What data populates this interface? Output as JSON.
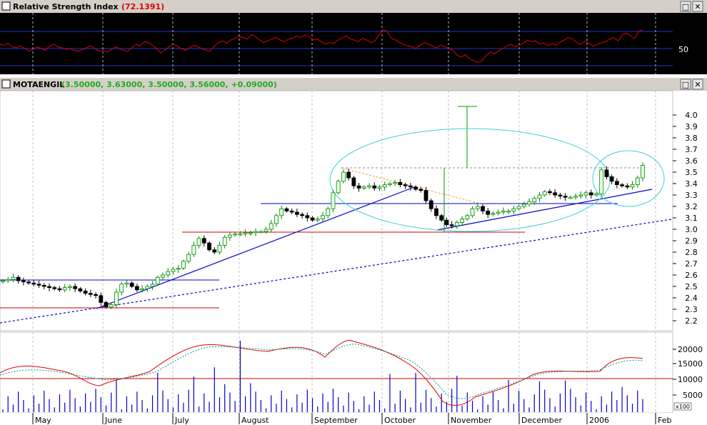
{
  "colors": {
    "background": "#000000",
    "panel_bg": "#ffffff",
    "titlebar": "#d4d0c8",
    "rsi_line": "#e00000",
    "grid": "#ffffff",
    "blue_line": "#0000cc",
    "red_line": "#cc0000",
    "up_candle": "#00a000",
    "down_candle": "#000000",
    "ellipse": "#40d0d0",
    "orange_line": "#ff9933",
    "macd_ma": "#009999"
  },
  "rsi_panel": {
    "title": "Relative Strength Index",
    "value": "(72.1391)",
    "level_label": "50",
    "rsi_values": [
      55,
      54,
      56,
      52,
      51,
      53,
      50,
      47,
      49,
      52,
      50,
      48,
      53,
      55,
      52,
      51,
      49,
      50,
      48,
      47,
      49,
      51,
      53,
      50,
      47,
      48,
      46,
      49,
      52,
      50,
      48,
      47,
      51,
      55,
      53,
      58,
      57,
      54,
      50,
      45,
      48,
      52,
      55,
      53,
      50,
      48,
      51,
      54,
      52,
      50,
      48,
      47,
      53,
      57,
      59,
      56,
      60,
      62,
      64,
      63,
      61,
      66,
      64,
      60,
      57,
      59,
      61,
      63,
      60,
      58,
      61,
      62,
      65,
      63,
      66,
      64,
      60,
      61,
      58,
      55,
      57,
      56,
      60,
      62,
      65,
      61,
      60,
      58,
      62,
      60,
      57,
      59,
      66,
      72,
      70,
      62,
      60,
      57,
      55,
      53,
      52,
      50,
      54,
      57,
      55,
      53,
      51,
      54,
      52,
      50,
      48,
      42,
      40,
      43,
      38,
      36,
      34,
      36,
      42,
      46,
      44,
      47,
      50,
      53,
      55,
      52,
      54,
      56,
      60,
      58,
      59,
      55,
      57,
      53,
      56,
      54,
      58,
      60,
      63,
      61,
      57,
      55,
      59,
      56,
      53,
      55,
      57,
      58,
      61,
      63,
      59,
      66,
      68,
      65,
      62,
      70,
      72
    ]
  },
  "price_panel": {
    "symbol": "MOTAENGIL",
    "ohlc_text": "(3.50000, 3.63000, 3.50000, 3.56000, +0.09000)",
    "yticks": [
      "4.0",
      "3.9",
      "3.8",
      "3.7",
      "3.6",
      "3.5",
      "3.4",
      "3.3",
      "3.2",
      "3.1",
      "3.0",
      "2.9",
      "2.8",
      "2.7",
      "2.6",
      "2.5",
      "2.4",
      "2.3",
      "2.2"
    ]
  },
  "volume_panel": {
    "yticks": [
      "20000",
      "15000",
      "10000",
      "5000"
    ],
    "multiplier": "x100"
  },
  "x_axis": {
    "months": [
      "May",
      "June",
      "July",
      "August",
      "September",
      "October",
      "November",
      "December",
      "2006",
      "Feb"
    ]
  },
  "chart_data": {
    "type": "candlestick",
    "y_range": [
      2.15,
      4.1
    ],
    "months": [
      "May",
      "June",
      "July",
      "August",
      "September",
      "October",
      "November",
      "December",
      "2006",
      "Feb"
    ],
    "close": [
      2.55,
      2.56,
      2.58,
      2.55,
      2.54,
      2.53,
      2.52,
      2.51,
      2.5,
      2.49,
      2.48,
      2.47,
      2.49,
      2.5,
      2.48,
      2.46,
      2.44,
      2.43,
      2.42,
      2.36,
      2.32,
      2.34,
      2.45,
      2.52,
      2.53,
      2.5,
      2.47,
      2.48,
      2.5,
      2.52,
      2.58,
      2.6,
      2.63,
      2.65,
      2.66,
      2.72,
      2.78,
      2.86,
      2.92,
      2.88,
      2.82,
      2.8,
      2.86,
      2.93,
      2.95,
      2.96,
      2.96,
      2.97,
      2.97,
      2.98,
      2.98,
      3.0,
      3.05,
      3.12,
      3.18,
      3.16,
      3.15,
      3.13,
      3.12,
      3.1,
      3.08,
      3.09,
      3.12,
      3.18,
      3.32,
      3.42,
      3.5,
      3.45,
      3.38,
      3.36,
      3.37,
      3.38,
      3.36,
      3.37,
      3.39,
      3.4,
      3.41,
      3.39,
      3.38,
      3.37,
      3.35,
      3.34,
      3.25,
      3.18,
      3.12,
      3.08,
      3.04,
      3.03,
      3.06,
      3.09,
      3.12,
      3.18,
      3.2,
      3.16,
      3.13,
      3.14,
      3.15,
      3.16,
      3.16,
      3.18,
      3.2,
      3.22,
      3.24,
      3.27,
      3.3,
      3.33,
      3.32,
      3.3,
      3.29,
      3.28,
      3.28,
      3.29,
      3.3,
      3.32,
      3.3,
      3.31,
      3.52,
      3.46,
      3.42,
      3.39,
      3.38,
      3.37,
      3.39,
      3.45,
      3.56
    ]
  }
}
